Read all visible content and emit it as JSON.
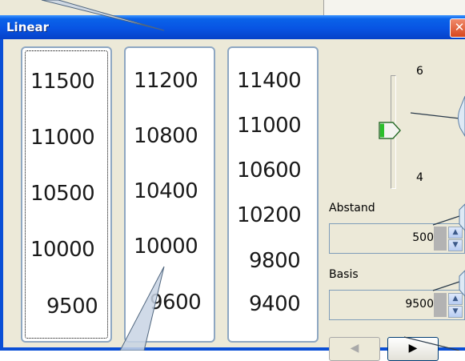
{
  "window": {
    "title": "Linear",
    "close_icon": "close-icon"
  },
  "columns": [
    {
      "selected": true,
      "values": [
        "11500",
        "11000",
        "10500",
        "10000",
        "9500"
      ]
    },
    {
      "selected": false,
      "values": [
        "11200",
        "10800",
        "10400",
        "10000",
        "9600"
      ]
    },
    {
      "selected": false,
      "values": [
        "11400",
        "11000",
        "10600",
        "10200",
        "9800",
        "9400"
      ]
    }
  ],
  "slider": {
    "max_label": "6",
    "min_label": "4",
    "thumb_color": "#2bbf2b"
  },
  "abstand": {
    "label": "Abstand",
    "value": "500"
  },
  "basis": {
    "label": "Basis",
    "value": "9500"
  },
  "nav": {
    "prev": "◀",
    "next": "▶"
  }
}
